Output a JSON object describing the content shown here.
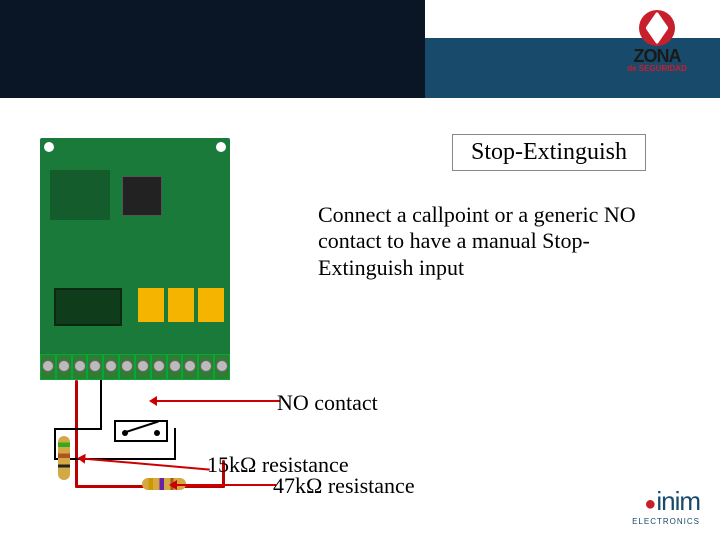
{
  "header": {
    "logo_top": {
      "brand": "ZONA",
      "sub": "de SEGURIDAD"
    },
    "logo_bottom": {
      "brand": "inim",
      "sub": "ELECTRONICS"
    }
  },
  "title": "Stop-Extinguish",
  "description": "Connect a callpoint or a generic NO contact to have a manual Stop-Extinguish input",
  "callouts": {
    "no_contact": "NO contact",
    "res_15k": "15kΩ resistance",
    "res_47k": "47kΩ resistance"
  }
}
